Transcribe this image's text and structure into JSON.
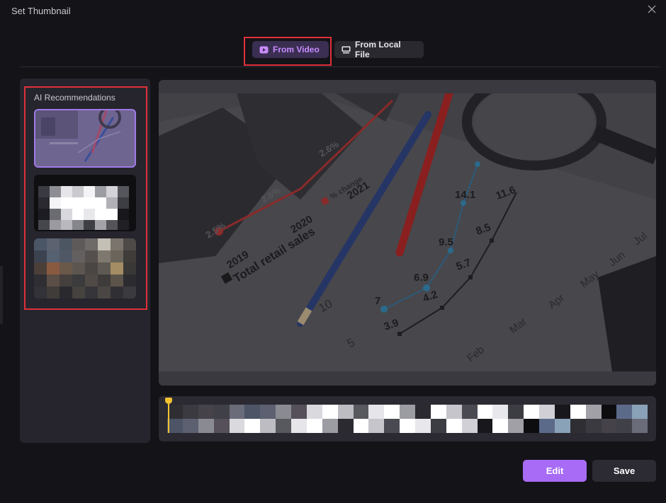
{
  "dialog": {
    "title": "Set Thumbnail",
    "close_icon": "close-icon"
  },
  "tabs": [
    {
      "label": "From Video",
      "icon": "video-play-icon",
      "active": true
    },
    {
      "label": "From Local File",
      "icon": "image-file-icon",
      "active": false
    }
  ],
  "sidebar": {
    "title": "AI Recommendations",
    "thumbnails": [
      {
        "name": "recommendation-1",
        "selected": true
      },
      {
        "name": "recommendation-2",
        "selected": false
      },
      {
        "name": "recommendation-3",
        "selected": false
      }
    ]
  },
  "preview": {
    "chart_labels": {
      "years": [
        "2019",
        "2020",
        "2021"
      ],
      "pcts": [
        "2.5%",
        "2.6%",
        "2.6%"
      ],
      "legend_sales": "Total retail sales",
      "legend_change": "% change",
      "points_blue": [
        "7",
        "6.9",
        "9.5",
        "14.1"
      ],
      "points_dark": [
        "3.9",
        "4.2",
        "5.7",
        "8.5",
        "11.6"
      ],
      "axis_left": [
        "10",
        "5"
      ],
      "months": [
        "Feb",
        "Mar",
        "Apr",
        "May",
        "Jun",
        "Jul"
      ]
    }
  },
  "actions": {
    "edit_label": "Edit",
    "save_label": "Save"
  },
  "colors": {
    "accent": "#a86bf5",
    "tab_active_text": "#c98bff",
    "playhead": "#f2c232",
    "highlight": "#e0303a"
  }
}
